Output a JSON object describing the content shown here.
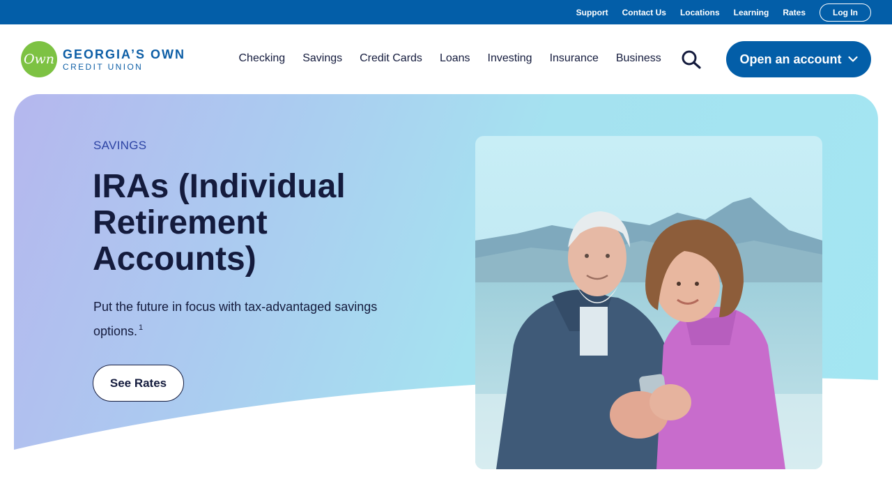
{
  "utility_nav": {
    "links": [
      "Support",
      "Contact Us",
      "Locations",
      "Learning",
      "Rates"
    ],
    "login_label": "Log In"
  },
  "brand": {
    "badge_text": "Own",
    "name_line1": "GEORGIA’S OWN",
    "name_line2": "CREDIT UNION"
  },
  "main_nav": {
    "items": [
      "Checking",
      "Savings",
      "Credit Cards",
      "Loans",
      "Investing",
      "Insurance",
      "Business"
    ],
    "open_account_label": "Open an account"
  },
  "hero": {
    "eyebrow": "SAVINGS",
    "title": "IRAs (Individual Retirement Accounts)",
    "description": "Put the future in focus with tax-advantaged savings options.",
    "footnote_marker": "1",
    "cta_label": "See Rates"
  },
  "colors": {
    "primary_blue": "#035ea8",
    "logo_green": "#7dc243",
    "navy_text": "#141b3d",
    "eyebrow_blue": "#2c43a4"
  },
  "icons": {
    "search": "search-icon",
    "dropdown": "chevron-down-icon"
  }
}
